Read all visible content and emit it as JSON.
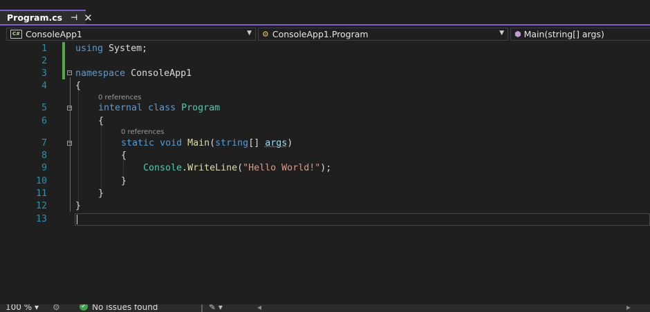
{
  "tab": {
    "title": "Program.cs",
    "pin_glyph": "⊣",
    "close_glyph": "✕"
  },
  "nav": {
    "project": "ConsoleApp1",
    "type": "ConsoleApp1.Program",
    "member": "Main(string[] args)",
    "project_icon": "csharp-project-icon",
    "type_icon": "class-icon",
    "member_icon": "method-icon"
  },
  "editor": {
    "line_numbers": [
      "1",
      "2",
      "3",
      "4",
      "5",
      "6",
      "7",
      "8",
      "9",
      "10",
      "11",
      "12",
      "13"
    ],
    "codelens": [
      "0 references",
      "0 references"
    ],
    "code": {
      "l1": {
        "kw": "using",
        "id": "System",
        "pu": ";"
      },
      "l3": {
        "kw": "namespace",
        "id": "ConsoleApp1"
      },
      "l4": {
        "pu": "{"
      },
      "l5": {
        "kw1": "internal",
        "kw2": "class",
        "ty": "Program"
      },
      "l6": {
        "pu": "{"
      },
      "l7": {
        "kw1": "static",
        "kw2": "void",
        "me": "Main",
        "p1": "(",
        "kw3": "string",
        "p2": "[] ",
        "pa": "args",
        "p3": ")"
      },
      "l8": {
        "pu": "{"
      },
      "l9": {
        "ty": "Console",
        "dot": ".",
        "me": "WriteLine",
        "p1": "(",
        "st": "\"Hello World!\"",
        "p2": ");"
      },
      "l10": {
        "pu": "}"
      },
      "l11": {
        "pu": "}"
      },
      "l12": {
        "pu": "}"
      }
    }
  },
  "status": {
    "zoom": "100 %",
    "issues": "No issues found"
  },
  "colors": {
    "accent": "#7f5fd0",
    "keyword": "#569cd6",
    "type": "#4ec9b0",
    "method": "#dcdcaa",
    "string": "#d69d85",
    "line_number": "#2b91af",
    "change_bar": "#57a64a"
  }
}
